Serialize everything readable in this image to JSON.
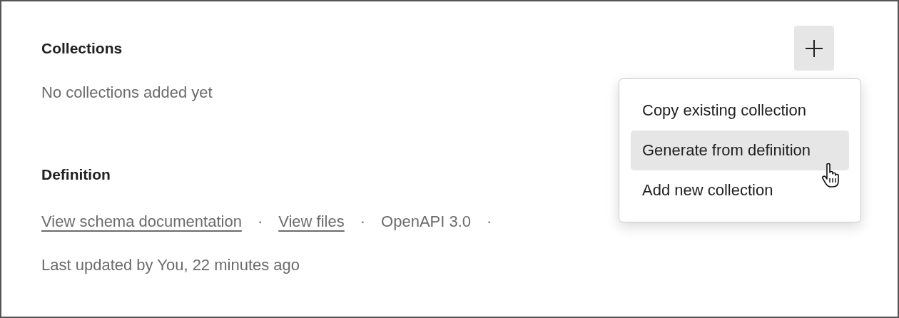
{
  "collections": {
    "title": "Collections",
    "empty_text": "No collections added yet"
  },
  "add_menu": {
    "items": [
      {
        "label": "Copy existing collection",
        "highlighted": false
      },
      {
        "label": "Generate from definition",
        "highlighted": true
      },
      {
        "label": "Add new collection",
        "highlighted": false
      }
    ]
  },
  "definition": {
    "title": "Definition",
    "meta": [
      {
        "kind": "link",
        "text": "View schema documentation"
      },
      {
        "kind": "separator",
        "text": "·"
      },
      {
        "kind": "link",
        "text": "View files"
      },
      {
        "kind": "separator",
        "text": "·"
      },
      {
        "kind": "text",
        "text": "OpenAPI 3.0"
      },
      {
        "kind": "separator",
        "text": "·"
      }
    ],
    "updated": "Last updated by You, 22 minutes ago"
  }
}
